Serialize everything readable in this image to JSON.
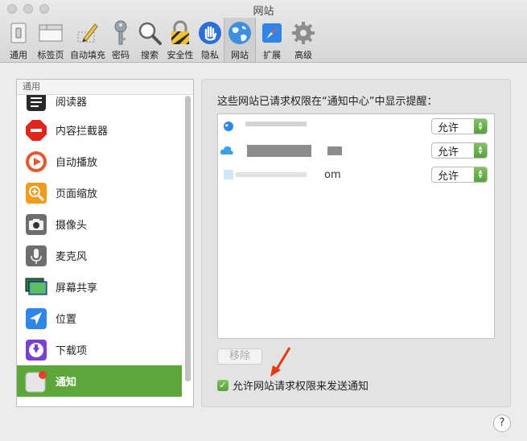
{
  "window": {
    "title": "网站"
  },
  "toolbar": {
    "tabs": [
      {
        "label": "通用",
        "icon": "switch-icon"
      },
      {
        "label": "标签页",
        "icon": "tabs-icon"
      },
      {
        "label": "自动填充",
        "icon": "pencil-icon"
      },
      {
        "label": "密码",
        "icon": "key-icon"
      },
      {
        "label": "搜索",
        "icon": "magnifier-icon"
      },
      {
        "label": "安全性",
        "icon": "lock-icon"
      },
      {
        "label": "隐私",
        "icon": "hand-icon"
      },
      {
        "label": "网站",
        "icon": "globe-icon",
        "active": true
      },
      {
        "label": "扩展",
        "icon": "compass-icon"
      },
      {
        "label": "高级",
        "icon": "gear-icon"
      }
    ]
  },
  "sidebar": {
    "section_header": "通用",
    "items": [
      {
        "label": "阅读器",
        "icon": "reader-icon"
      },
      {
        "label": "内容拦截器",
        "icon": "stop-sign-icon"
      },
      {
        "label": "自动播放",
        "icon": "play-icon"
      },
      {
        "label": "页面缩放",
        "icon": "zoom-icon"
      },
      {
        "label": "摄像头",
        "icon": "camera-icon"
      },
      {
        "label": "麦克风",
        "icon": "microphone-icon"
      },
      {
        "label": "屏幕共享",
        "icon": "screen-share-icon"
      },
      {
        "label": "位置",
        "icon": "location-icon"
      },
      {
        "label": "下载项",
        "icon": "download-icon"
      },
      {
        "label": "通知",
        "icon": "notification-icon",
        "selected": true
      }
    ]
  },
  "main": {
    "title": "这些网站已请求权限在“通知中心”中显示提醒：",
    "sites": [
      {
        "name": "",
        "permission": "允许"
      },
      {
        "name": "",
        "permission": "允许"
      },
      {
        "name": "om",
        "permission": "允许"
      }
    ],
    "remove_label": "移除",
    "allow_requests_label": "允许网站请求权限来发送通知",
    "allow_requests_checked": true
  },
  "help_label": "?",
  "colors": {
    "accent": "#5ca73a",
    "arrow": "#e8380d"
  }
}
